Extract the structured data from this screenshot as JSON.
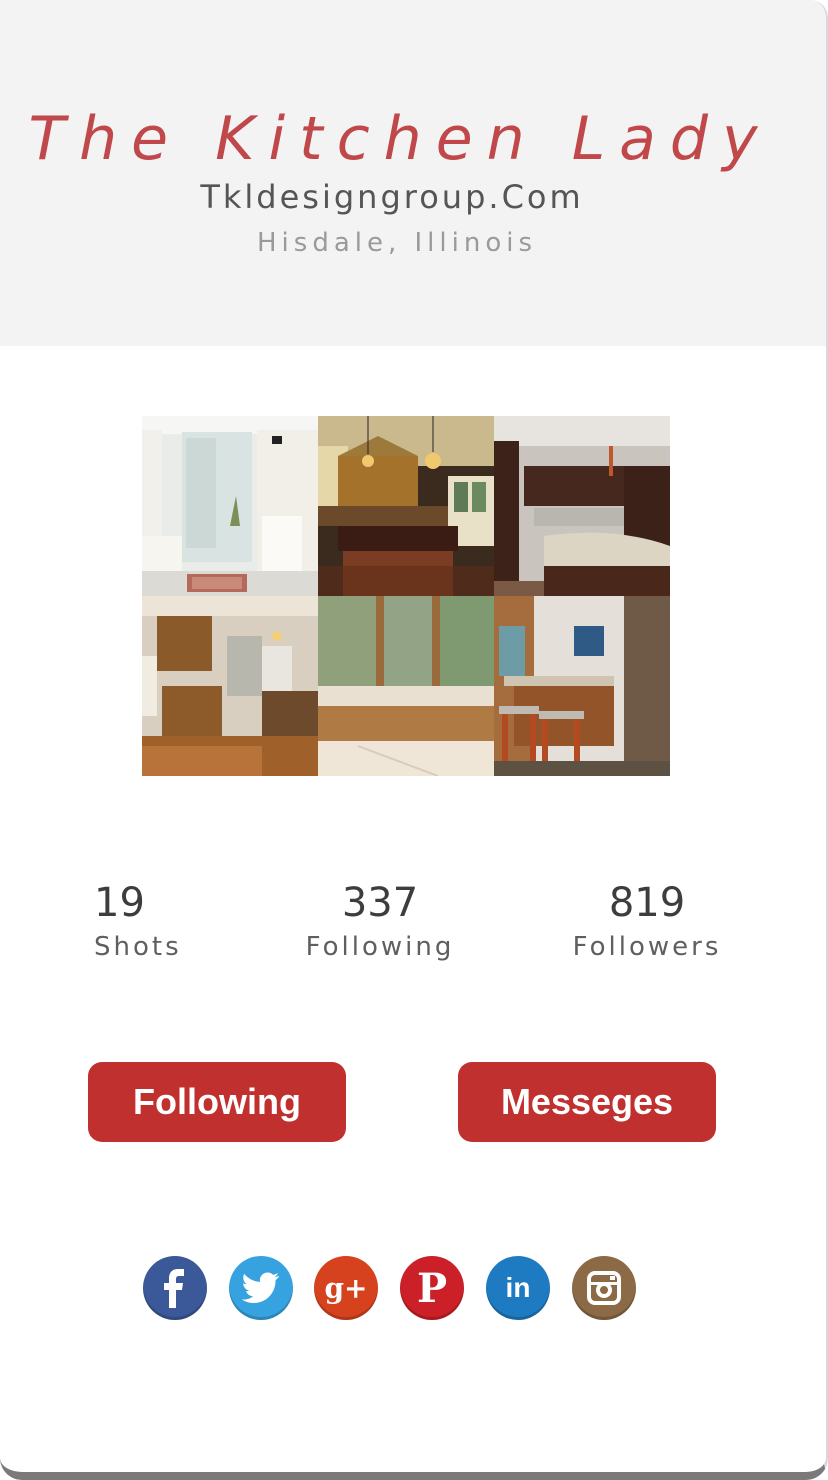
{
  "header": {
    "brand": "The Kitchen Lady",
    "website": "Tkldesigngroup.Com",
    "location": "Hisdale, Illinois"
  },
  "gallery": {
    "images": [
      "kitchen-photo-1",
      "kitchen-photo-2",
      "kitchen-photo-3",
      "kitchen-photo-4",
      "kitchen-photo-5",
      "kitchen-photo-6"
    ]
  },
  "stats": {
    "shots": {
      "value": "19",
      "label": "Shots"
    },
    "following": {
      "value": "337",
      "label": "Following"
    },
    "followers": {
      "value": "819",
      "label": "Followers"
    }
  },
  "buttons": {
    "following": "Following",
    "messages": "Messeges"
  },
  "social": {
    "icons": [
      "facebook-icon",
      "twitter-icon",
      "google-plus-icon",
      "pinterest-icon",
      "linkedin-icon",
      "instagram-icon"
    ]
  },
  "colors": {
    "accent": "#c0302f",
    "brand_text": "#c0474a",
    "facebook": "#3b5998",
    "twitter": "#36a3e0",
    "google_plus": "#d6421e",
    "pinterest": "#cb2027",
    "linkedin": "#1f7bc1",
    "instagram": "#8b6a45"
  }
}
